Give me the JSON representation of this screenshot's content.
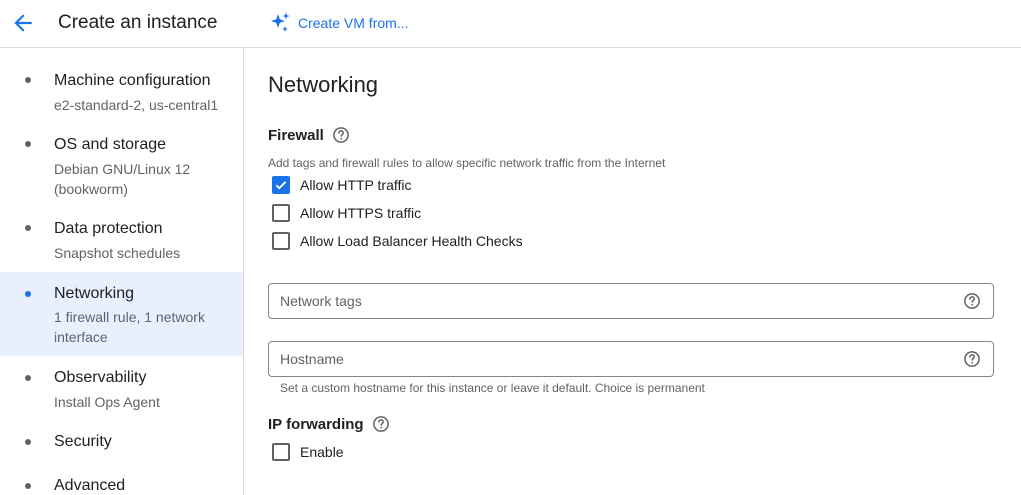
{
  "header": {
    "title": "Create an instance",
    "create_vm_label": "Create VM from...",
    "back_icon": "arrow-back-icon",
    "create_icon": "sparkle-icon"
  },
  "sidebar": {
    "items": [
      {
        "title": "Machine configuration",
        "subtitle": "e2-standard-2, us-central1"
      },
      {
        "title": "OS and storage",
        "subtitle": "Debian GNU/Linux 12 (bookworm)"
      },
      {
        "title": "Data protection",
        "subtitle": "Snapshot schedules"
      },
      {
        "title": "Networking",
        "subtitle": "1 firewall rule, 1 network interface",
        "active": true
      },
      {
        "title": "Observability",
        "subtitle": "Install Ops Agent"
      },
      {
        "title": "Security",
        "subtitle": ""
      },
      {
        "title": "Advanced",
        "subtitle": ""
      }
    ]
  },
  "main": {
    "section_title": "Networking",
    "firewall": {
      "heading": "Firewall",
      "description": "Add tags and firewall rules to allow specific network traffic from the Internet",
      "options": [
        {
          "label": "Allow HTTP traffic",
          "checked": true
        },
        {
          "label": "Allow HTTPS traffic",
          "checked": false
        },
        {
          "label": "Allow Load Balancer Health Checks",
          "checked": false
        }
      ]
    },
    "network_tags": {
      "placeholder": "Network tags",
      "value": ""
    },
    "hostname": {
      "placeholder": "Hostname",
      "value": "",
      "hint": "Set a custom hostname for this instance or leave it default. Choice is permanent"
    },
    "ip_forwarding": {
      "heading": "IP forwarding",
      "enable_label": "Enable",
      "checked": false
    }
  },
  "colors": {
    "accent": "#1a73e8",
    "active_bg": "#e8f0fe",
    "border": "#dadce0"
  }
}
